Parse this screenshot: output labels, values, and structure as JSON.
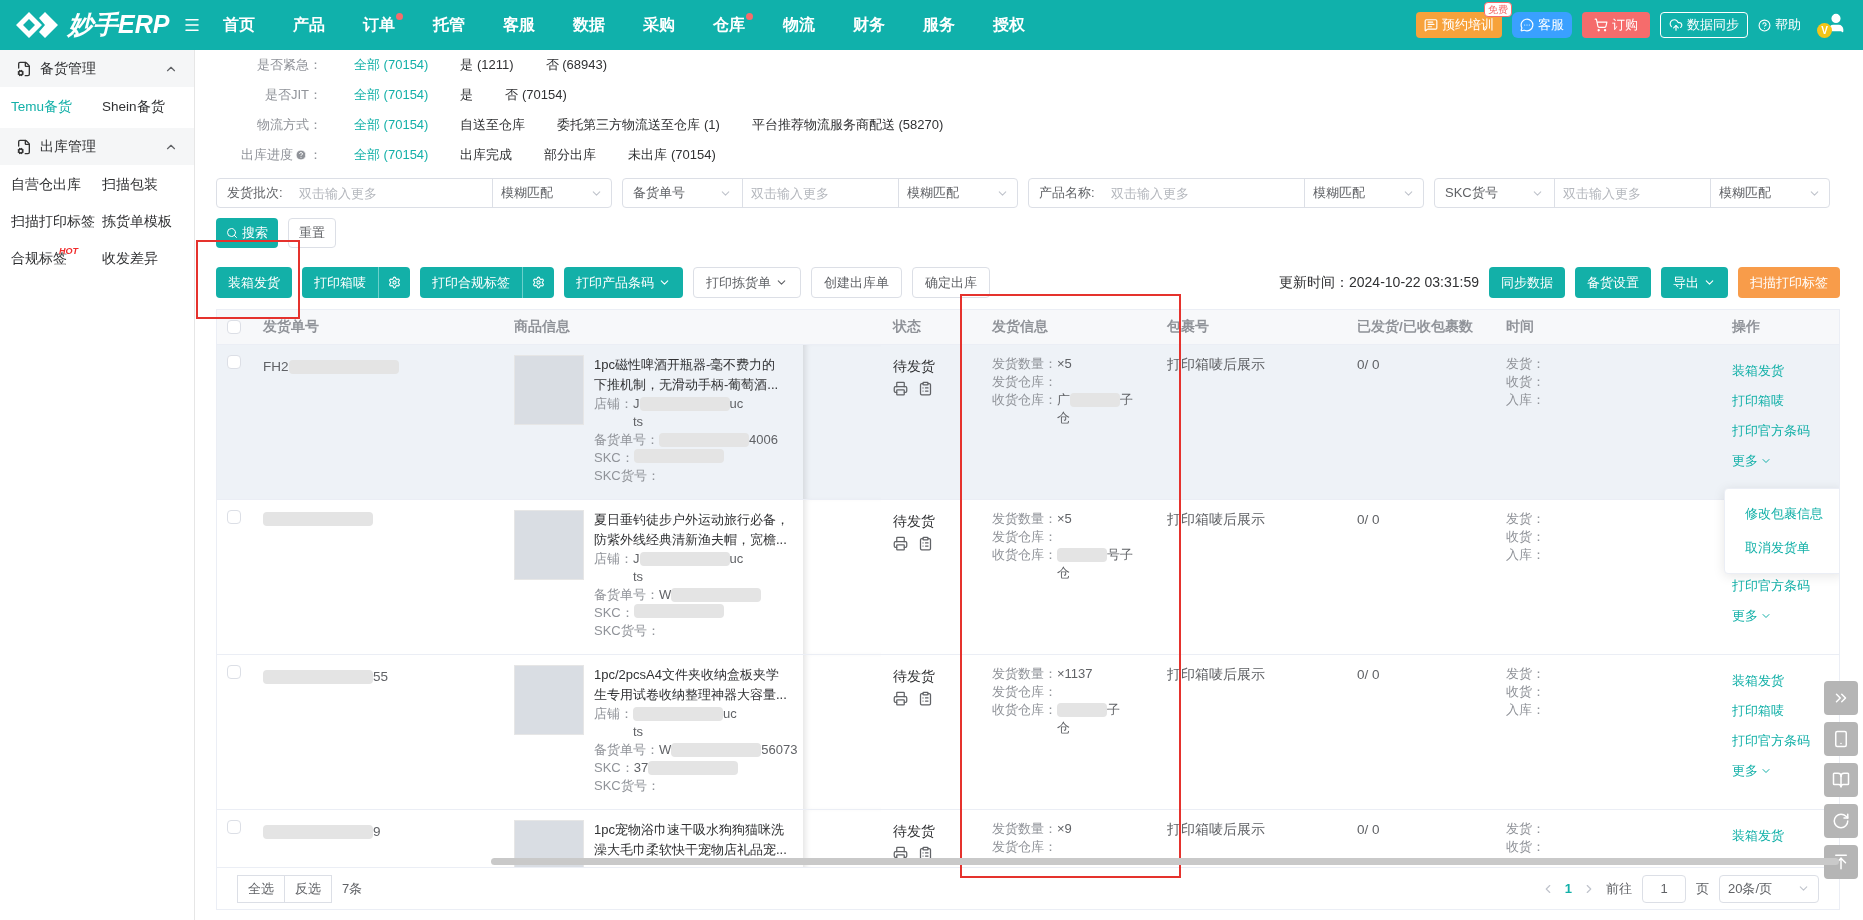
{
  "topbar": {
    "brand": "妙手ERP",
    "nav": [
      {
        "label": "首页",
        "dot": false
      },
      {
        "label": "产品",
        "dot": false
      },
      {
        "label": "订单",
        "dot": true
      },
      {
        "label": "托管",
        "dot": false
      },
      {
        "label": "客服",
        "dot": false
      },
      {
        "label": "数据",
        "dot": false
      },
      {
        "label": "采购",
        "dot": false
      },
      {
        "label": "仓库",
        "dot": true
      },
      {
        "label": "物流",
        "dot": false
      },
      {
        "label": "财务",
        "dot": false
      },
      {
        "label": "服务",
        "dot": false
      },
      {
        "label": "授权",
        "dot": false
      }
    ],
    "actions": [
      {
        "kind": "training",
        "label": "预约培训",
        "badge": "免费"
      },
      {
        "kind": "service",
        "label": "客服"
      },
      {
        "kind": "order",
        "label": "订购"
      },
      {
        "kind": "sync",
        "label": "数据同步"
      },
      {
        "kind": "help",
        "label": "帮助"
      }
    ],
    "avatar_badge": "V"
  },
  "sidebar": [
    {
      "title": "备货管理",
      "expanded": true,
      "items": [
        {
          "label": "Temu备货",
          "selected": true
        },
        {
          "label": "Shein备货",
          "selected": false
        }
      ]
    },
    {
      "title": "出库管理",
      "expanded": true,
      "items": [
        {
          "label": "自营仓出库",
          "selected": false
        },
        {
          "label": "扫描包装",
          "selected": false
        },
        {
          "label": "扫描打印标签",
          "selected": false
        },
        {
          "label": "拣货单模板",
          "selected": false
        },
        {
          "label": "合规标签",
          "selected": false,
          "badge": "HOT"
        },
        {
          "label": "收发差异",
          "selected": false
        }
      ]
    }
  ],
  "filters": [
    {
      "label": "是否紧急：",
      "options": [
        {
          "text": "全部 (70154)",
          "selected": true
        },
        {
          "text": "是 (1211)",
          "selected": false
        },
        {
          "text": "否 (68943)",
          "selected": false
        }
      ]
    },
    {
      "label": "是否JIT：",
      "options": [
        {
          "text": "全部 (70154)",
          "selected": true
        },
        {
          "text": "是",
          "selected": false
        },
        {
          "text": "否 (70154)",
          "selected": false
        }
      ]
    },
    {
      "label": "物流方式：",
      "options": [
        {
          "text": "全部 (70154)",
          "selected": true
        },
        {
          "text": "自送至仓库",
          "selected": false
        },
        {
          "text": "委托第三方物流送至仓库 (1)",
          "selected": false
        },
        {
          "text": "平台推荐物流服务商配送 (58270)",
          "selected": false
        }
      ]
    },
    {
      "label": "出库进度",
      "help": true,
      "suffix": "：",
      "options": [
        {
          "text": "全部 (70154)",
          "selected": true
        },
        {
          "text": "出库完成",
          "selected": false
        },
        {
          "text": "部分出库",
          "selected": false
        },
        {
          "text": "未出库 (70154)",
          "selected": false
        }
      ]
    }
  ],
  "search_fields": [
    {
      "kind": "label",
      "label": "发货批次:",
      "placeholder": "双击输入更多",
      "match": "模糊匹配"
    },
    {
      "kind": "select",
      "label": "备货单号",
      "placeholder": "双击输入更多",
      "match": "模糊匹配"
    },
    {
      "kind": "label",
      "label": "产品名称:",
      "placeholder": "双击输入更多",
      "match": "模糊匹配"
    },
    {
      "kind": "select",
      "label": "SKC货号",
      "placeholder": "双击输入更多",
      "match": "模糊匹配"
    }
  ],
  "search_button": "搜索",
  "reset_button": "重置",
  "toolbar": [
    {
      "kind": "primary",
      "label": "装箱发货"
    },
    {
      "kind": "split",
      "label": "打印箱唛"
    },
    {
      "kind": "split",
      "label": "打印合规标签"
    },
    {
      "kind": "primary-dropdown",
      "label": "打印产品条码"
    },
    {
      "kind": "outline-dropdown",
      "label": "打印拣货单"
    },
    {
      "kind": "outline",
      "label": "创建出库单"
    },
    {
      "kind": "outline",
      "label": "确定出库"
    }
  ],
  "updated": "更新时间：2024-10-22 03:31:59",
  "toolbar_right": [
    {
      "kind": "primary",
      "label": "同步数据"
    },
    {
      "kind": "primary",
      "label": "备货设置"
    },
    {
      "kind": "primary-dropdown",
      "label": "导出"
    },
    {
      "kind": "warning",
      "label": "扫描打印标签"
    }
  ],
  "table": {
    "header_checked": false,
    "columns": [
      "发货单号",
      "商品信息",
      "状态",
      "发货信息",
      "包裹号",
      "已发货/已收包裹数",
      "时间",
      "操作"
    ],
    "rows": [
      {
        "checked": false,
        "hovered": true,
        "shipment": {
          "before": "FH2",
          "blurred": true
        },
        "title_lines": [
          "1pc磁性啤酒开瓶器-毫不费力的",
          "下推机制，无滑动手柄-葡萄酒..."
        ],
        "fields": [
          {
            "label": "店铺：",
            "before": "J",
            "blurred": true,
            "after": "uc",
            "continuation": "ts"
          },
          {
            "label": "备货单号：",
            "blurred": true,
            "after": "4006"
          },
          {
            "label": "SKC：",
            "blurred": true
          },
          {
            "label": "SKC货号："
          }
        ],
        "status": "待发货",
        "shipping": [
          {
            "label": "发货数量：",
            "value": "×5"
          },
          {
            "label": "发货仓库："
          },
          {
            "label": "收货仓库：",
            "before": "广",
            "blurred": true,
            "after": "子",
            "continuation": "仓"
          }
        ],
        "package": "打印箱唛后展示",
        "counts": "0/ 0",
        "times": [
          "发货：",
          "收货：",
          "入库："
        ],
        "actions": [
          {
            "kind": "link",
            "label": "装箱发货"
          },
          {
            "kind": "link",
            "label": "打印箱唛"
          },
          {
            "kind": "link",
            "label": "打印官方条码"
          },
          {
            "kind": "more",
            "label": "更多"
          }
        ],
        "menu": [
          "修改包裹信息",
          "取消发货单"
        ]
      },
      {
        "checked": false,
        "hovered": false,
        "shipment": {
          "blurred": true
        },
        "title_lines": [
          "夏日垂钓徒步户外运动旅行必备，",
          "防紫外线经典清新渔夫帽，宽檐..."
        ],
        "fields": [
          {
            "label": "店铺：",
            "before": "J",
            "blurred": true,
            "after": "uc",
            "continuation": "ts"
          },
          {
            "label": "备货单号：",
            "before": "W",
            "blurred": true
          },
          {
            "label": "SKC：",
            "blurred": true
          },
          {
            "label": "SKC货号："
          }
        ],
        "status": "待发货",
        "shipping": [
          {
            "label": "发货数量：",
            "value": "×5"
          },
          {
            "label": "发货仓库："
          },
          {
            "label": "收货仓库：",
            "blurred": true,
            "after": "号子",
            "continuation": "仓"
          }
        ],
        "package": "打印箱唛后展示",
        "counts": "0/ 0",
        "times": [
          "发货：",
          "收货：",
          "入库："
        ],
        "actions": [
          {
            "kind": "link",
            "label": "打印官方条码"
          },
          {
            "kind": "more",
            "label": "更多"
          }
        ]
      },
      {
        "checked": false,
        "hovered": false,
        "shipment": {
          "blurred": true,
          "after": "55"
        },
        "title_lines": [
          "1pc/2pcsA4文件夹收纳盒板夹学",
          "生专用试卷收纳整理神器大容量..."
        ],
        "fields": [
          {
            "label": "店铺：",
            "blurred": true,
            "after": "uc",
            "continuation": "ts"
          },
          {
            "label": "备货单号：",
            "before": "W",
            "blurred": true,
            "after": "56073"
          },
          {
            "label": "SKC：",
            "before": "37",
            "blurred": true
          },
          {
            "label": "SKC货号："
          }
        ],
        "status": "待发货",
        "shipping": [
          {
            "label": "发货数量：",
            "value": "×1137"
          },
          {
            "label": "发货仓库："
          },
          {
            "label": "收货仓库：",
            "blurred": true,
            "after": "子",
            "continuation": "仓"
          }
        ],
        "package": "打印箱唛后展示",
        "counts": "0/ 0",
        "times": [
          "发货：",
          "收货：",
          "入库："
        ],
        "actions": [
          {
            "kind": "link",
            "label": "装箱发货"
          },
          {
            "kind": "link",
            "label": "打印箱唛"
          },
          {
            "kind": "link",
            "label": "打印官方条码"
          },
          {
            "kind": "more",
            "label": "更多"
          }
        ]
      },
      {
        "checked": false,
        "hovered": false,
        "shipment": {
          "blurred": true,
          "after": "9"
        },
        "title_lines": [
          "1pc宠物浴巾速干吸水狗狗猫咪洗",
          "澡大毛巾柔软快干宠物店礼品宠..."
        ],
        "fields": [],
        "status": "待发货",
        "shipping": [
          {
            "label": "发货数量：",
            "value": "×9"
          },
          {
            "label": "发货仓库："
          }
        ],
        "package": "打印箱唛后展示",
        "counts": "0/ 0",
        "times": [
          "发货：",
          "收货："
        ],
        "actions": [
          {
            "kind": "link",
            "label": "装箱发货"
          }
        ]
      }
    ]
  },
  "footer": {
    "buttons": [
      "全选",
      "反选"
    ],
    "count": "7条",
    "pages": [
      {
        "label": "1",
        "selected": true
      }
    ],
    "goto": "前往",
    "page_input": "1",
    "page_suffix": "页",
    "page_size": "20条/页"
  }
}
